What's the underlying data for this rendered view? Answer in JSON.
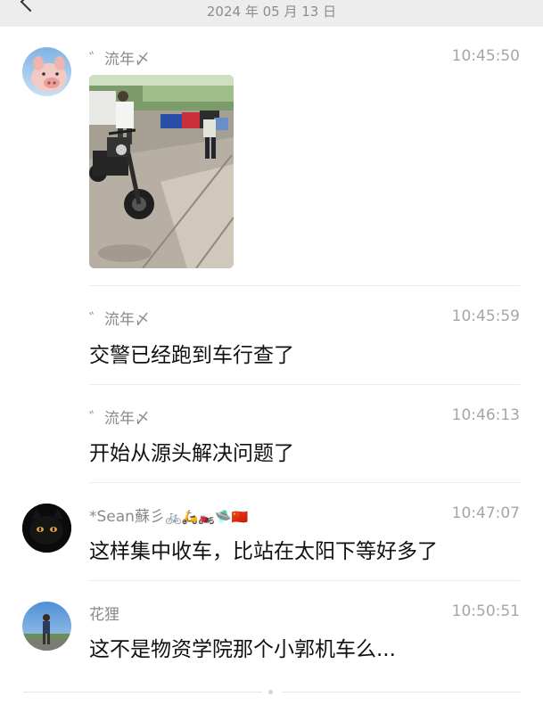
{
  "date_header": "2024 年 05 月 13 日",
  "messages": [
    {
      "sender": "゛流年〆",
      "time": "10:45:50",
      "type": "image",
      "image_description": "motorcycle on sidewalk with traffic police"
    },
    {
      "sender": "゛流年〆",
      "time": "10:45:59",
      "text": "交警已经跑到车行查了"
    },
    {
      "sender": "゛流年〆",
      "time": "10:46:13",
      "text": "开始从源头解决问题了"
    },
    {
      "sender": "*Sean蘇彡",
      "sender_emojis": "🚲🛵🏍️🛸🇨🇳",
      "time": "10:47:07",
      "text": "这样集中收车，比站在太阳下等好多了"
    },
    {
      "sender": "花狸",
      "time": "10:50:51",
      "text": "这不是物资学院那个小郭机车么..."
    }
  ],
  "icons": {
    "back": "chevron-left-icon"
  }
}
